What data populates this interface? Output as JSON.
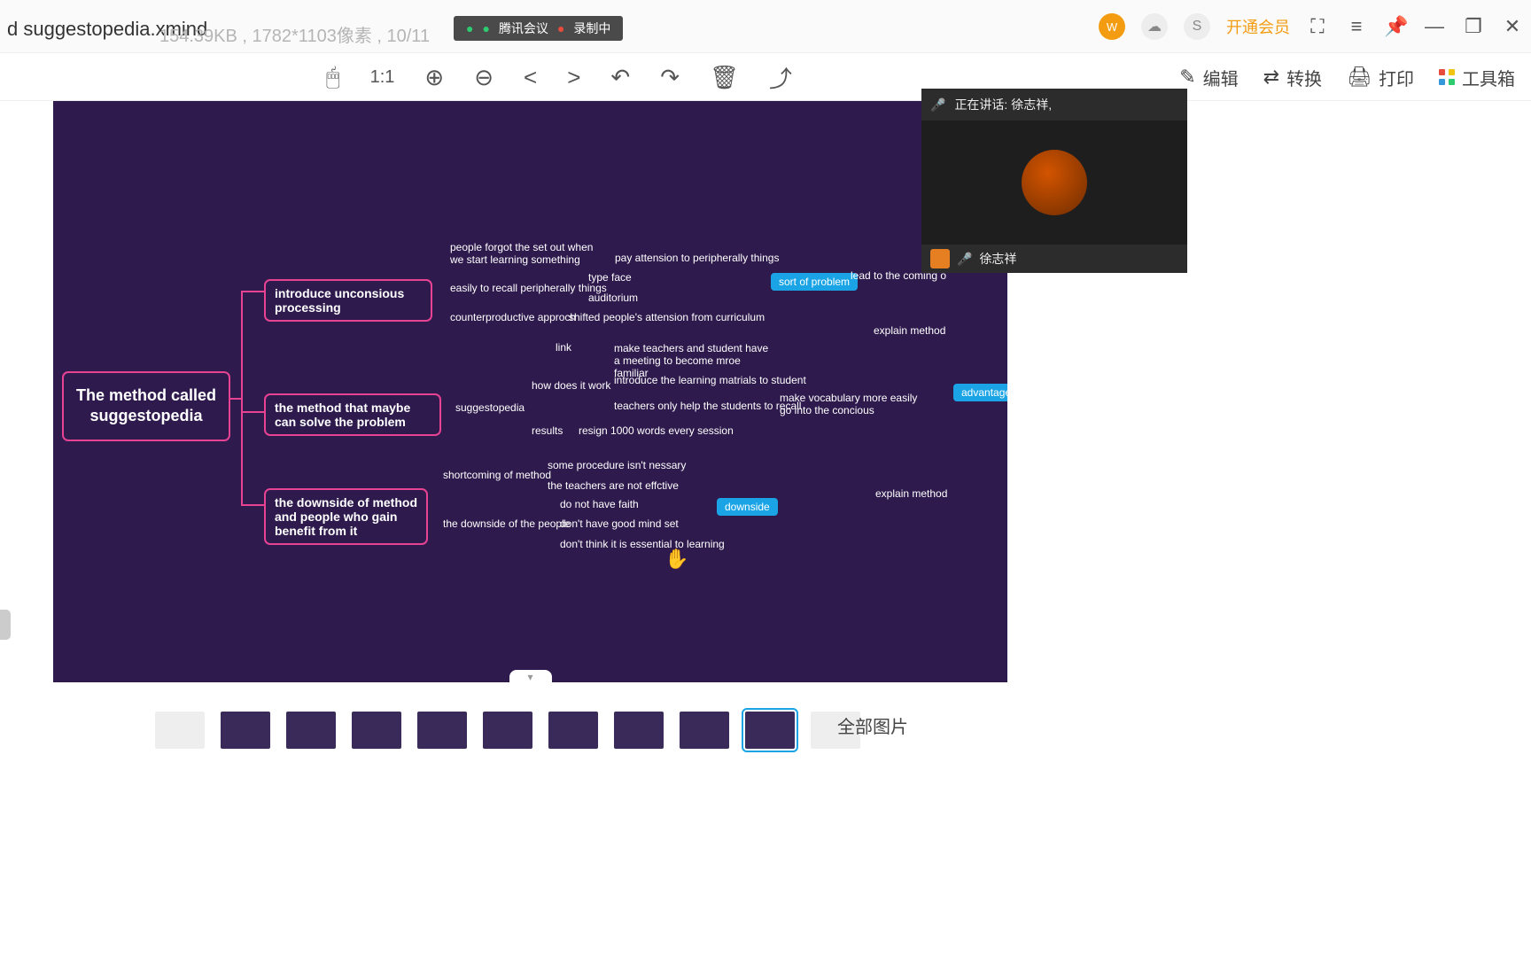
{
  "titlebar": {
    "filename": "d suggestopedia.xmind",
    "filesize": "154.39KB",
    "dimensions": "1782*1103像素",
    "index": "10/11",
    "meeting_app": "腾讯会议",
    "meeting_state": "录制中",
    "avatar_initials": "W",
    "vip_label": "开通会员"
  },
  "toolbar": {
    "zoom11": "1:1",
    "edit": "编辑",
    "convert": "转换",
    "print": "打印",
    "toolbox": "工具箱"
  },
  "mindmap": {
    "root": "The method called suggestopedia",
    "b1": "introduce unconsious processing",
    "b2": "the method that maybe can solve the problem",
    "b3": "the downside of method and people who gain benefit from it",
    "n_forgot": "people forgot the set out when we start learning something",
    "n_periph": "pay attension to peripherally things",
    "n_recall": "easily to recall peripherally things",
    "n_typeface": "type face",
    "n_audit": "auditorium",
    "n_counter": "counterproductive approch",
    "n_shift": "shifted people's attension from curriculum",
    "n_link": "link",
    "n_how": "how does it work",
    "n_sugg": "suggestopedia",
    "n_results": "results",
    "n_meet": "make teachers and student have a meeting to become mroe familiar",
    "n_introm": "introduce the learning matrials to student",
    "n_help": "teachers only help the students to recall",
    "n_vocab": "make vocabulary more easily go into the concious",
    "n_1000": "resign 1000 words every session",
    "n_shortm": "shortcoming of method",
    "n_proc": "some procedure isn't nessary",
    "n_teff": "the teachers are not effctive",
    "n_dpeople": "the downside of the people",
    "n_faith": "do not have faith",
    "n_mind": "don't have good mind set",
    "n_ess": "don't think it is essential to learning",
    "n_lead": "lead to the coming o",
    "n_exp1": "explain method",
    "n_exp2": "explain method",
    "tag_problem": "sort of problem",
    "tag_adv": "advantage",
    "tag_down": "downside"
  },
  "overlay": {
    "speaking_label": "正在讲话: 徐志祥,",
    "user": "徐志祥"
  },
  "thumbs": {
    "all": "全部图片"
  },
  "notch_glyph": "▾"
}
